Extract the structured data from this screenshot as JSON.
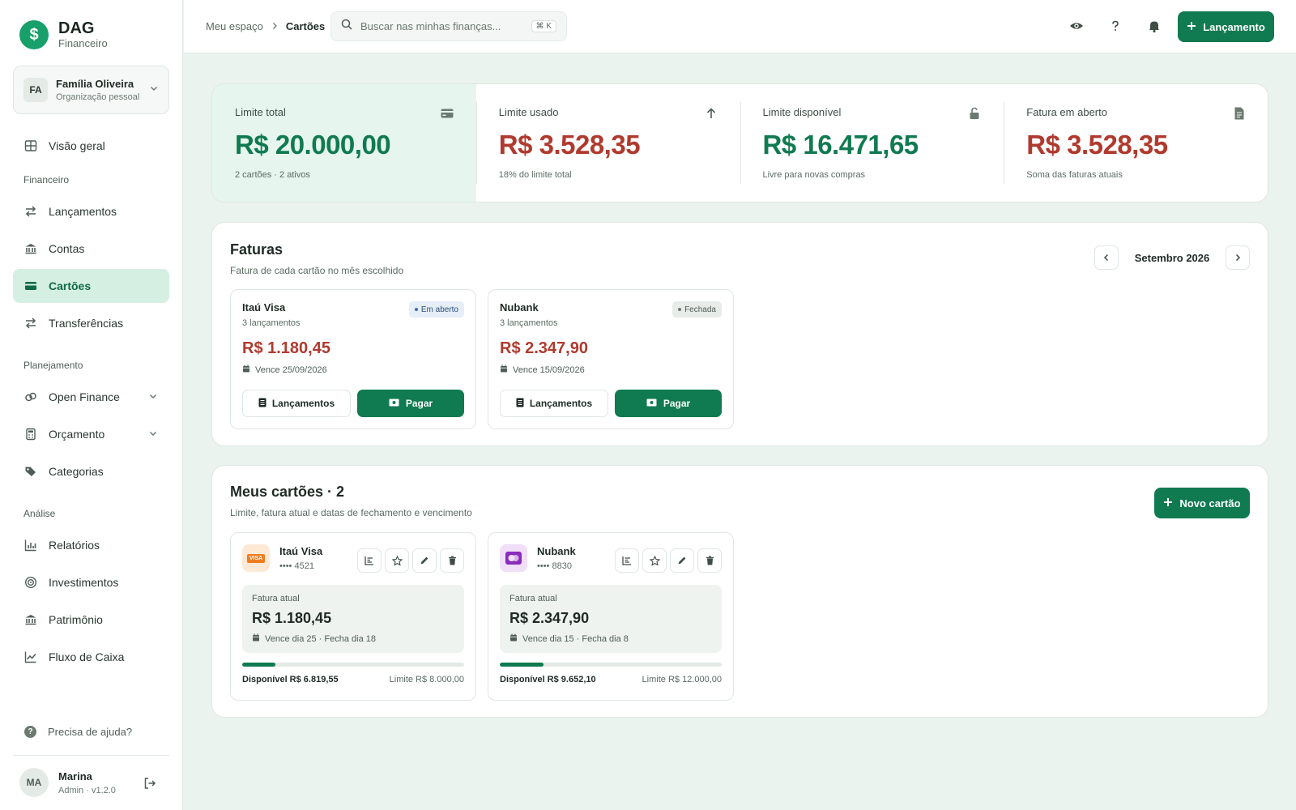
{
  "brand": {
    "name": "DAG",
    "sub": "Financeiro",
    "logo_glyph": "$"
  },
  "org": {
    "initials": "FA",
    "name": "Família Oliveira",
    "sub": "Organização pessoal"
  },
  "nav": {
    "overview": "Visão geral",
    "section_financeiro": "Financeiro",
    "lancamentos": "Lançamentos",
    "contas": "Contas",
    "cartoes": "Cartões",
    "transferencias": "Transferências",
    "section_planejamento": "Planejamento",
    "open_finance": "Open Finance",
    "orcamento": "Orçamento",
    "categorias": "Categorias",
    "section_analise": "Análise",
    "relatorios": "Relatórios",
    "investimentos": "Investimentos",
    "patrimonio": "Patrimônio",
    "fluxo": "Fluxo de Caixa",
    "active": "cartoes"
  },
  "help": "Precisa de ajuda?",
  "user": {
    "initials": "MA",
    "name": "Marina",
    "sub": "Admin · v1.2.0"
  },
  "topbar": {
    "breadcrumb_root": "Meu espaço",
    "breadcrumb_current": "Cartões",
    "search_placeholder": "Buscar nas minhas finanças...",
    "search_shortcut": "⌘ K",
    "launch_button": "Lançamento"
  },
  "summary": [
    {
      "label": "Limite total",
      "value": "R$ 20.000,00",
      "note": "2 cartões · 2 ativos",
      "icon": "credit-card-icon",
      "tone": "green"
    },
    {
      "label": "Limite usado",
      "value": "R$ 3.528,35",
      "note": "18% do limite total",
      "icon": "arrow-up-icon",
      "tone": "red"
    },
    {
      "label": "Limite disponível",
      "value": "R$ 16.471,65",
      "note": "Livre para novas compras",
      "icon": "unlock-icon",
      "tone": "green"
    },
    {
      "label": "Fatura em aberto",
      "value": "R$ 3.528,35",
      "note": "Soma das faturas atuais",
      "icon": "invoice-icon",
      "tone": "red"
    }
  ],
  "faturas": {
    "title": "Faturas",
    "subtitle": "Fatura de cada cartão no mês escolhido",
    "month": "Setembro 2026",
    "items": [
      {
        "name": "Itaú Visa",
        "count": "3 lançamentos",
        "status": "Em aberto",
        "status_kind": "open",
        "amount": "R$ 1.180,45",
        "due": "Vence 25/09/2026",
        "entries_button": "Lançamentos",
        "pay_button": "Pagar"
      },
      {
        "name": "Nubank",
        "count": "3 lançamentos",
        "status": "Fechada",
        "status_kind": "closed",
        "amount": "R$ 2.347,90",
        "due": "Vence 15/09/2026",
        "entries_button": "Lançamentos",
        "pay_button": "Pagar"
      }
    ]
  },
  "cards": {
    "title": "Meus cartões · 2",
    "subtitle": "Limite, fatura atual e datas de fechamento e vencimento",
    "new_button": "Novo cartão",
    "items": [
      {
        "name": "Itaú Visa",
        "number": "•••• 4521",
        "brand_label": "VISA",
        "logo_color": "#f07d1f",
        "logo_bg": "#fde9d6",
        "current_label": "Fatura atual",
        "current": "R$ 1.180,45",
        "dates": "Vence dia 25 · Fecha dia 18",
        "available": "Disponível R$ 6.819,55",
        "limit": "Limite R$ 8.000,00",
        "used_fraction": 0.148
      },
      {
        "name": "Nubank",
        "number": "•••• 8830",
        "brand_label": "",
        "logo_color": "#8a2bbd",
        "logo_bg": "#f1def8",
        "current_label": "Fatura atual",
        "current": "R$ 2.347,90",
        "dates": "Vence dia 15 · Fecha dia 8",
        "available": "Disponível R$ 9.652,10",
        "limit": "Limite R$ 12.000,00",
        "used_fraction": 0.196
      }
    ]
  },
  "colors": {
    "accent": "#107a50",
    "negative": "#b03a2e",
    "active_bg": "#d6efe3"
  }
}
